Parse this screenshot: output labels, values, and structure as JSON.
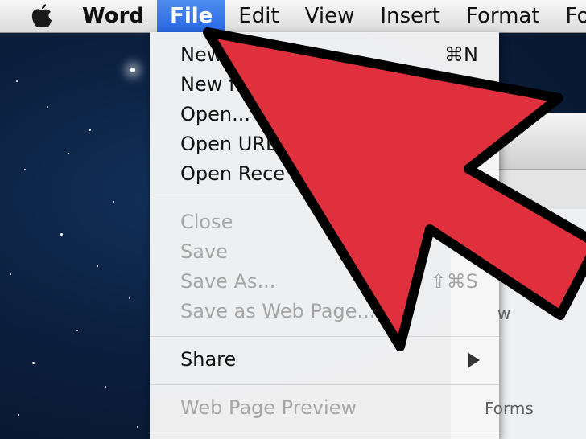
{
  "menubar": {
    "apple_icon": "apple-icon",
    "items": [
      {
        "label": "Word",
        "app": true
      },
      {
        "label": "File",
        "active": true
      },
      {
        "label": "Edit"
      },
      {
        "label": "View"
      },
      {
        "label": "Insert"
      },
      {
        "label": "Format"
      },
      {
        "label": "Font"
      }
    ]
  },
  "file_menu": {
    "items": [
      {
        "label": "New",
        "shortcut": "⌘N",
        "enabled": true
      },
      {
        "label": "New f",
        "shortcut": "",
        "enabled": true
      },
      {
        "label": "Open...",
        "shortcut": "",
        "enabled": true
      },
      {
        "label": "Open URL",
        "shortcut": "",
        "enabled": true
      },
      {
        "label": "Open Rece",
        "shortcut": "",
        "enabled": true
      },
      {
        "label": "Close",
        "shortcut": "",
        "enabled": false
      },
      {
        "label": "Save",
        "shortcut": "",
        "enabled": false
      },
      {
        "label": "Save As...",
        "shortcut": "⇧⌘S",
        "enabled": false
      },
      {
        "label": "Save as Web Page...",
        "shortcut": "",
        "enabled": false
      },
      {
        "label": "Share",
        "shortcut": "",
        "enabled": true,
        "submenu": true
      },
      {
        "label": "Web Page Preview",
        "shortcut": "",
        "enabled": false
      }
    ]
  },
  "ghost_text": {
    "layout_view": "w",
    "forms": "Forms"
  },
  "colors": {
    "arrow_fill": "#e0303d",
    "arrow_stroke": "#000000",
    "menu_highlight": "#2f6fe6"
  }
}
